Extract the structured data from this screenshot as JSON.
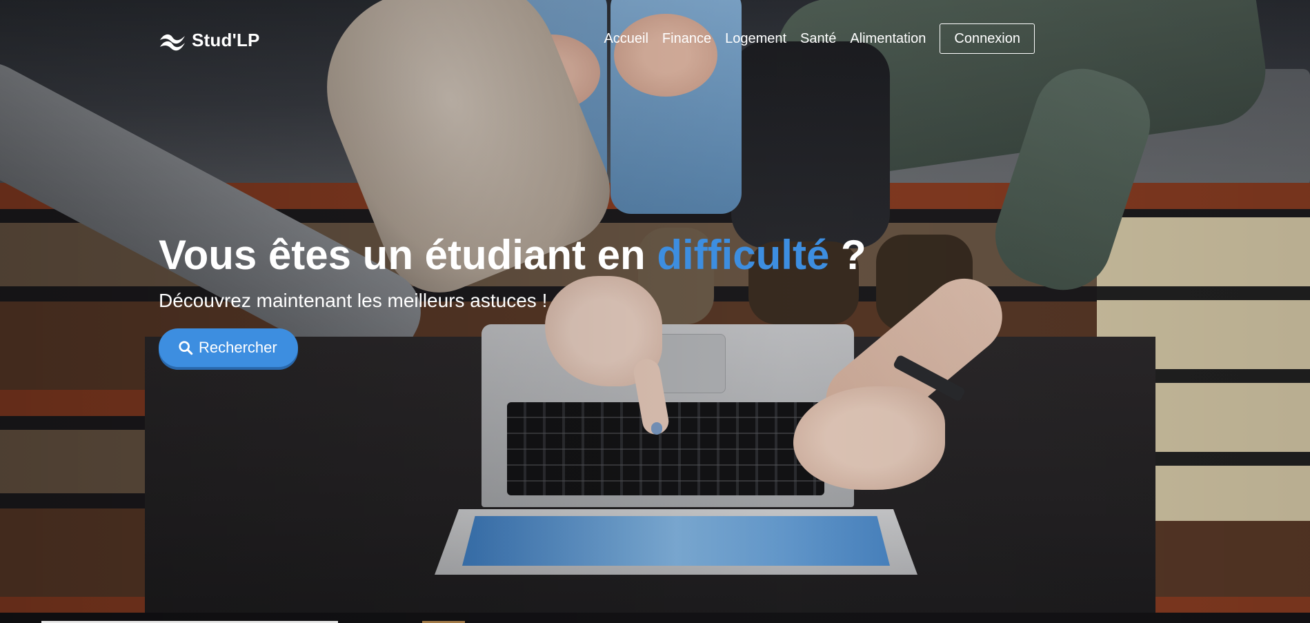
{
  "brand": {
    "name": "Stud'LP",
    "logo_icon": "wave-logo-icon"
  },
  "nav": {
    "links": [
      {
        "label": "Accueil"
      },
      {
        "label": "Finance"
      },
      {
        "label": "Logement"
      },
      {
        "label": "Santé"
      },
      {
        "label": "Alimentation"
      }
    ],
    "login_label": "Connexion"
  },
  "hero": {
    "headline_start": "Vous êtes un étudiant en ",
    "headline_accent": "difficulté",
    "headline_end": " ?",
    "subtitle": "Découvrez maintenant les meilleurs astuces !",
    "search_label": "Rechercher",
    "search_icon": "search-icon"
  },
  "colors": {
    "accent": "#3d8ee0",
    "text": "#ffffff"
  }
}
